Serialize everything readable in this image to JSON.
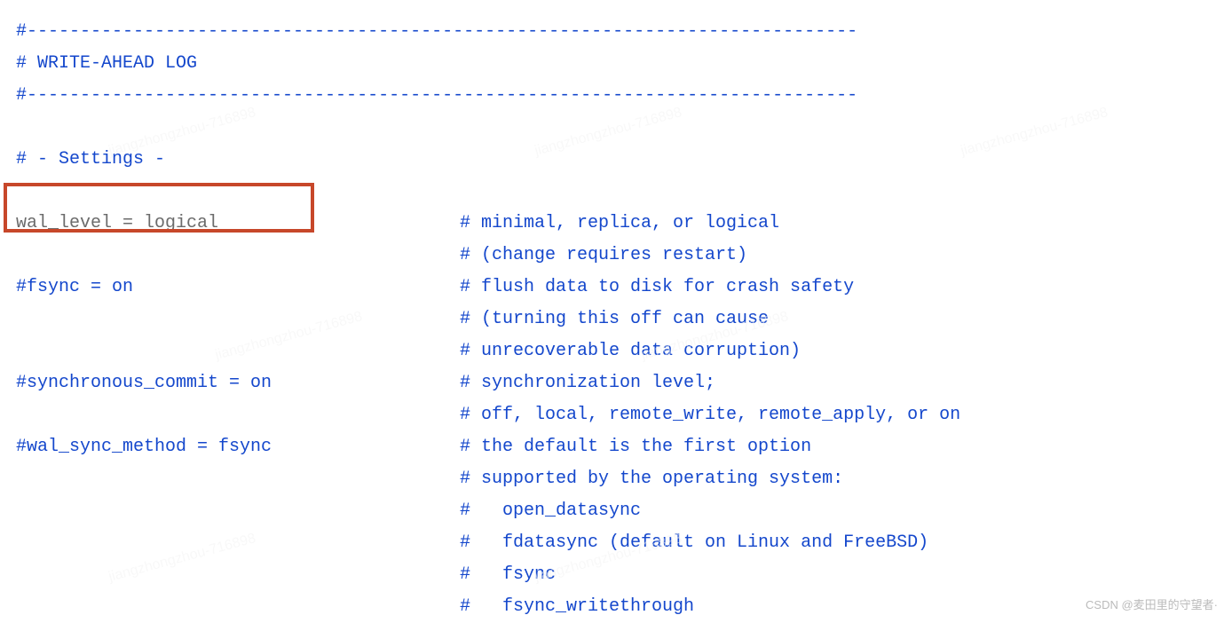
{
  "lines": [
    {
      "left": "#------------------------------------------------------------------------------",
      "leftClass": "comment",
      "right": ""
    },
    {
      "left": "# WRITE-AHEAD LOG",
      "leftClass": "comment",
      "right": ""
    },
    {
      "left": "#------------------------------------------------------------------------------",
      "leftClass": "comment",
      "right": ""
    },
    {
      "left": "",
      "leftClass": "",
      "right": ""
    },
    {
      "left": "# - Settings -",
      "leftClass": "comment",
      "right": ""
    },
    {
      "left": "",
      "leftClass": "",
      "right": ""
    },
    {
      "left": "wal_level = logical",
      "leftClass": "setting",
      "right": "# minimal, replica, or logical",
      "rightClass": "comment"
    },
    {
      "left": "",
      "leftClass": "",
      "right": "# (change requires restart)",
      "rightClass": "comment"
    },
    {
      "left": "#fsync = on",
      "leftClass": "comment",
      "right": "# flush data to disk for crash safety",
      "rightClass": "comment"
    },
    {
      "left": "",
      "leftClass": "",
      "right": "# (turning this off can cause",
      "rightClass": "comment"
    },
    {
      "left": "",
      "leftClass": "",
      "right": "# unrecoverable data corruption)",
      "rightClass": "comment"
    },
    {
      "left": "#synchronous_commit = on",
      "leftClass": "comment",
      "right": "# synchronization level;",
      "rightClass": "comment"
    },
    {
      "left": "",
      "leftClass": "",
      "right": "# off, local, remote_write, remote_apply, or on",
      "rightClass": "comment"
    },
    {
      "left": "#wal_sync_method = fsync",
      "leftClass": "comment",
      "right": "# the default is the first option",
      "rightClass": "comment"
    },
    {
      "left": "",
      "leftClass": "",
      "right": "# supported by the operating system:",
      "rightClass": "comment"
    },
    {
      "left": "",
      "leftClass": "",
      "right": "#   open_datasync",
      "rightClass": "comment"
    },
    {
      "left": "",
      "leftClass": "",
      "right": "#   fdatasync (default on Linux and FreeBSD)",
      "rightClass": "comment"
    },
    {
      "left": "",
      "leftClass": "",
      "right": "#   fsync",
      "rightClass": "comment"
    },
    {
      "left": "",
      "leftClass": "",
      "right": "#   fsync_writethrough",
      "rightClass": "comment"
    }
  ],
  "watermark": "CSDN @麦田里的守望者·",
  "faintWatermark": "jiangzhongzhou-716898"
}
